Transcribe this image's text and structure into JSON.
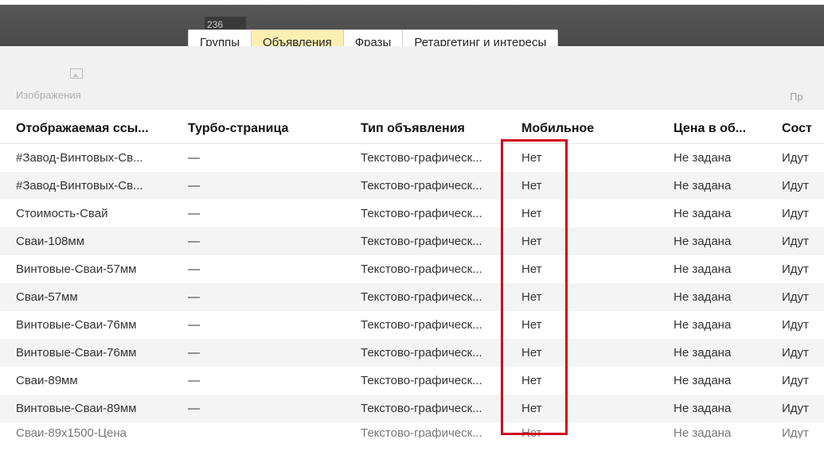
{
  "header": {
    "count": "236",
    "tabs": [
      {
        "label": "Группы",
        "active": false
      },
      {
        "label": "Объявления",
        "active": true
      },
      {
        "label": "Фразы",
        "active": false
      },
      {
        "label": "Ретаргетинг и интересы",
        "active": false
      }
    ]
  },
  "toolbar": {
    "images_label": "Изображения",
    "right_label": "Пр"
  },
  "table": {
    "columns": [
      "Отображаемая ссы...",
      "Турбо-страница",
      "Тип объявления",
      "Мобильное",
      "Цена в об...",
      "Сост"
    ],
    "rows": [
      [
        "#Завод-Винтовых-Св...",
        "—",
        "Текстово-графическ...",
        "Нет",
        "Не задана",
        "Идут"
      ],
      [
        "#Завод-Винтовых-Св...",
        "—",
        "Текстово-графическ...",
        "Нет",
        "Не задана",
        "Идут"
      ],
      [
        "Стоимость-Свай",
        "—",
        "Текстово-графическ...",
        "Нет",
        "Не задана",
        "Идут"
      ],
      [
        "Сваи-108мм",
        "—",
        "Текстово-графическ...",
        "Нет",
        "Не задана",
        "Идут"
      ],
      [
        "Винтовые-Сваи-57мм",
        "—",
        "Текстово-графическ...",
        "Нет",
        "Не задана",
        "Идут"
      ],
      [
        "Сваи-57мм",
        "—",
        "Текстово-графическ...",
        "Нет",
        "Не задана",
        "Идут"
      ],
      [
        "Винтовые-Сваи-76мм",
        "—",
        "Текстово-графическ...",
        "Нет",
        "Не задана",
        "Идут"
      ],
      [
        "Винтовые-Сваи-76мм",
        "—",
        "Текстово-графическ...",
        "Нет",
        "Не задана",
        "Идут"
      ],
      [
        "Сваи-89мм",
        "—",
        "Текстово-графическ...",
        "Нет",
        "Не задана",
        "Идут"
      ],
      [
        "Винтовые-Сваи-89мм",
        "—",
        "Текстово-графическ...",
        "Нет",
        "Не задана",
        "Идут"
      ],
      [
        "Сваи-89х1500-Цена",
        "",
        "Текстово-графическ...",
        "Нет",
        "Не задана",
        "Идут"
      ]
    ]
  },
  "colors": {
    "active_tab": "#fdefb2",
    "highlight": "#d0021b",
    "top_band": "#4f4f4f"
  }
}
